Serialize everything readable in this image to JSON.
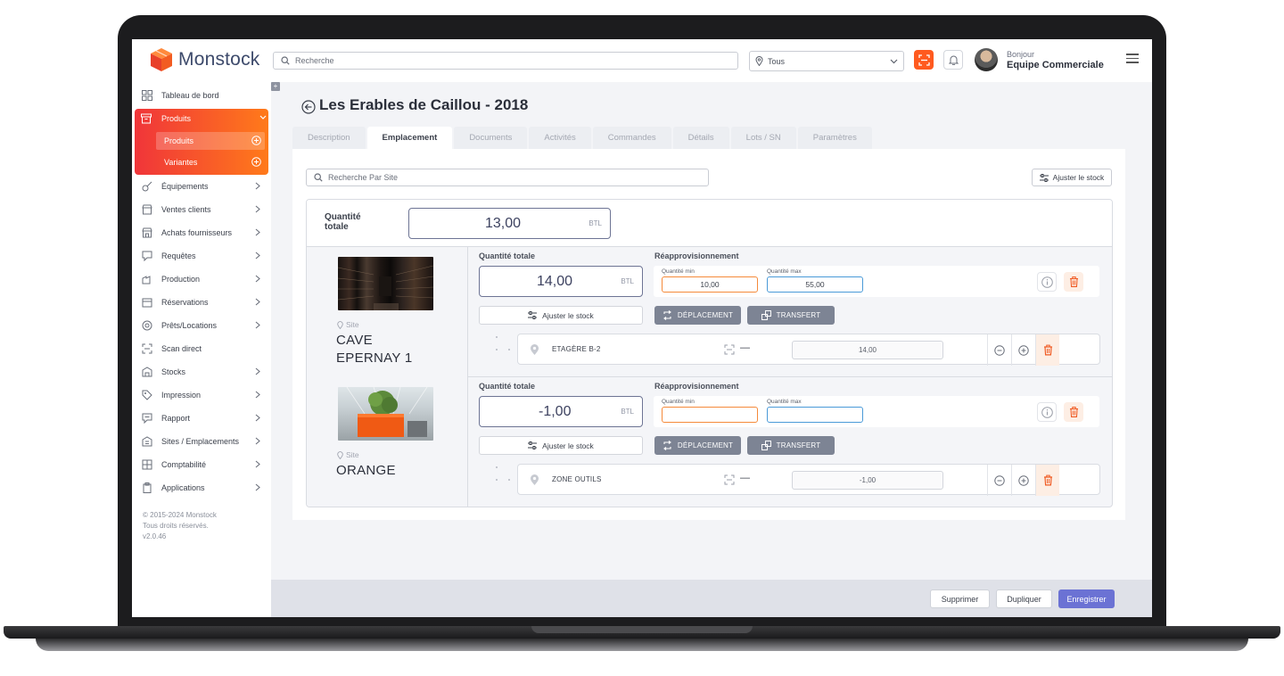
{
  "app": {
    "name": "Monstock"
  },
  "topbar": {
    "search_placeholder": "Recherche",
    "location_filter": "Tous",
    "greeting": "Bonjour",
    "user_name": "Equipe Commerciale"
  },
  "sidebar": {
    "items": [
      {
        "label": "Tableau de bord",
        "icon": "dashboard-icon"
      },
      {
        "label": "Produits",
        "icon": "archive-icon"
      },
      {
        "label": "Équipements",
        "icon": "tools-icon"
      },
      {
        "label": "Ventes clients",
        "icon": "store-icon"
      },
      {
        "label": "Achats fournisseurs",
        "icon": "shop-icon"
      },
      {
        "label": "Requêtes",
        "icon": "request-icon"
      },
      {
        "label": "Production",
        "icon": "production-icon"
      },
      {
        "label": "Réservations",
        "icon": "calendar-icon"
      },
      {
        "label": "Prêts/Locations",
        "icon": "location-icon"
      },
      {
        "label": "Scan direct",
        "icon": "scan-icon"
      },
      {
        "label": "Stocks",
        "icon": "stocks-icon"
      },
      {
        "label": "Impression",
        "icon": "tag-icon"
      },
      {
        "label": "Rapport",
        "icon": "report-icon"
      },
      {
        "label": "Sites / Emplacements",
        "icon": "building-icon"
      },
      {
        "label": "Comptabilité",
        "icon": "accounting-icon"
      },
      {
        "label": "Applications",
        "icon": "clipboard-icon"
      }
    ],
    "sub_items": [
      {
        "label": "Produits"
      },
      {
        "label": "Variantes"
      }
    ],
    "copyright": [
      "© 2015-2024 Monstock",
      "Tous droits réservés.",
      "v2.0.46"
    ]
  },
  "page": {
    "title": "Les Erables de Caillou - 2018",
    "tabs": [
      "Description",
      "Emplacement",
      "Documents",
      "Activités",
      "Commandes",
      "Détails",
      "Lots / SN",
      "Paramètres"
    ],
    "active_tab": "Emplacement",
    "site_search_placeholder": "Recherche Par Site",
    "adjust_stock_label": "Ajuster le stock",
    "total_label": "Quantité totale",
    "total_value": "13,00",
    "unit": "BTL"
  },
  "sites": [
    {
      "tag": "Site",
      "name_line1": "CAVE",
      "name_line2": "EPERNAY 1",
      "qty_label": "Quantité totale",
      "qty_value": "14,00",
      "unit": "BTL",
      "reappro_label": "Réapprovisionnement",
      "min_label": "Quantité min",
      "min_value": "10,00",
      "max_label": "Quantité max",
      "max_value": "55,00",
      "adjust_label": "Ajuster le stock",
      "move_label": "DÉPLACEMENT",
      "transfer_label": "TRANSFERT",
      "location": {
        "name": "ETAGÈRE B-2",
        "dash": "—",
        "qty": "14,00"
      }
    },
    {
      "tag": "Site",
      "name_line1": "ORANGE",
      "name_line2": "",
      "qty_label": "Quantité totale",
      "qty_value": "-1,00",
      "unit": "BTL",
      "reappro_label": "Réapprovisionnement",
      "min_label": "Quantité min",
      "min_value": "",
      "max_label": "Quantité max",
      "max_value": "",
      "adjust_label": "Ajuster le stock",
      "move_label": "DÉPLACEMENT",
      "transfer_label": "TRANSFERT",
      "location": {
        "name": "ZONE OUTILS",
        "dash": "—",
        "qty": "-1,00"
      }
    }
  ],
  "footer": {
    "delete_label": "Supprimer",
    "duplicate_label": "Dupliquer",
    "save_label": "Enregistrer"
  },
  "colors": {
    "accent": "#ff5a1f",
    "brand_gradient_start": "#f0353a",
    "brand_gradient_end": "#ff7a1a",
    "primary_button": "#6b72d4",
    "dark_button": "#7d8494"
  }
}
